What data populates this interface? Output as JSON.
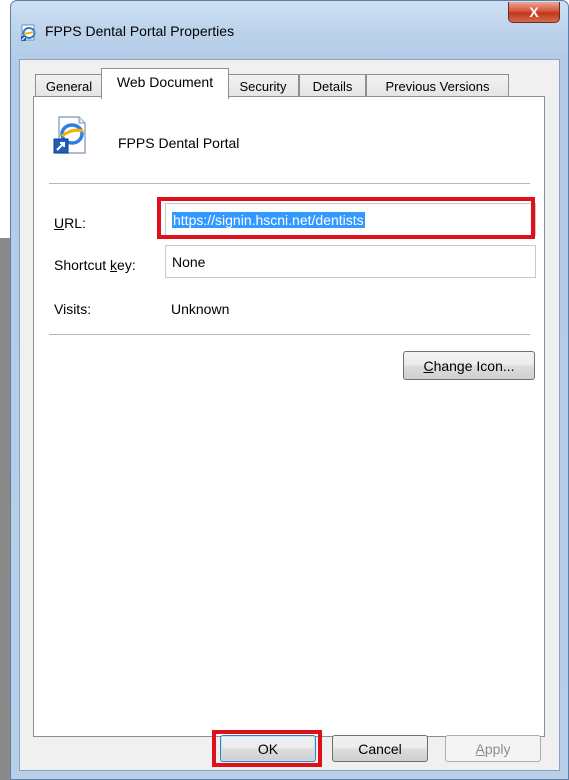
{
  "window": {
    "title": "FPPS Dental Portal Properties",
    "close_label": "X"
  },
  "tabs": [
    {
      "label": "General",
      "active": false
    },
    {
      "label": "Web Document",
      "active": true
    },
    {
      "label": "Security",
      "active": false
    },
    {
      "label": "Details",
      "active": false
    },
    {
      "label": "Previous Versions",
      "active": false
    }
  ],
  "document": {
    "name": "FPPS Dental Portal",
    "icon": "internet-shortcut-icon"
  },
  "url": {
    "label_accel": "U",
    "label_rest": "RL:",
    "value": "https://signin.hscni.net/dentists",
    "selected": true
  },
  "shortcut_key": {
    "label_pre": "Shortcut ",
    "label_accel": "k",
    "label_post": "ey:",
    "value": "None"
  },
  "visits": {
    "label": "Visits:",
    "value": "Unknown"
  },
  "change_icon": {
    "accel": "C",
    "rest": "hange Icon..."
  },
  "buttons": {
    "ok": "OK",
    "cancel": "Cancel",
    "apply_accel": "A",
    "apply_rest": "pply"
  },
  "colors": {
    "highlight_box": "#e0101a",
    "selection": "#3399ff",
    "close_button": "#c1361b"
  }
}
